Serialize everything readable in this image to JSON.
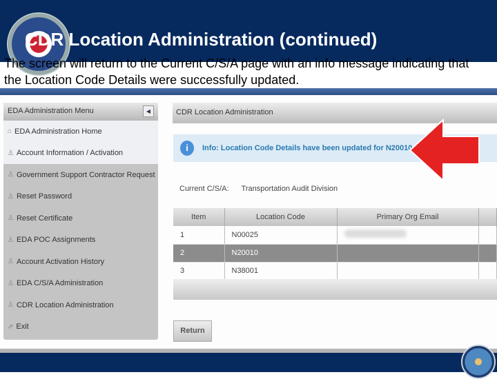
{
  "slide": {
    "title": "CDR Location Administration (continued)",
    "description": "The screen will return to the Current C/S/A page with an info message indicating that the Location Code Details were successfully updated."
  },
  "menu": {
    "header": "EDA Administration Menu",
    "items": [
      {
        "label": "EDA Administration Home",
        "icon": "home-icon"
      },
      {
        "label": "Account Information / Activation",
        "icon": "user-icon"
      },
      {
        "label": "Government Support Contractor Request",
        "icon": "user-icon"
      },
      {
        "label": "Reset Password",
        "icon": "user-icon"
      },
      {
        "label": "Reset Certificate",
        "icon": "user-icon"
      },
      {
        "label": "EDA POC Assignments",
        "icon": "user-icon"
      },
      {
        "label": "Account Activation History",
        "icon": "user-icon"
      },
      {
        "label": "EDA C/S/A Administration",
        "icon": "user-icon"
      },
      {
        "label": "CDR Location Administration",
        "icon": "user-icon"
      },
      {
        "label": "Exit",
        "icon": "exit-icon"
      }
    ]
  },
  "main": {
    "panel_title": "CDR Location Administration",
    "info": "Info: Location Code Details have been updated for N20010",
    "csa_label": "Current C/S/A:",
    "csa_value": "Transportation Audit Division",
    "table": {
      "headers": [
        "Item",
        "Location Code",
        "Primary Org Email"
      ],
      "rows": [
        [
          "1",
          "N00025"
        ],
        [
          "2",
          "N20010"
        ],
        [
          "3",
          "N38001"
        ]
      ]
    },
    "return_label": "Return"
  },
  "colors": {
    "navy": "#062a5e",
    "info_text": "#2a7ab0",
    "arrow": "#e52222"
  }
}
